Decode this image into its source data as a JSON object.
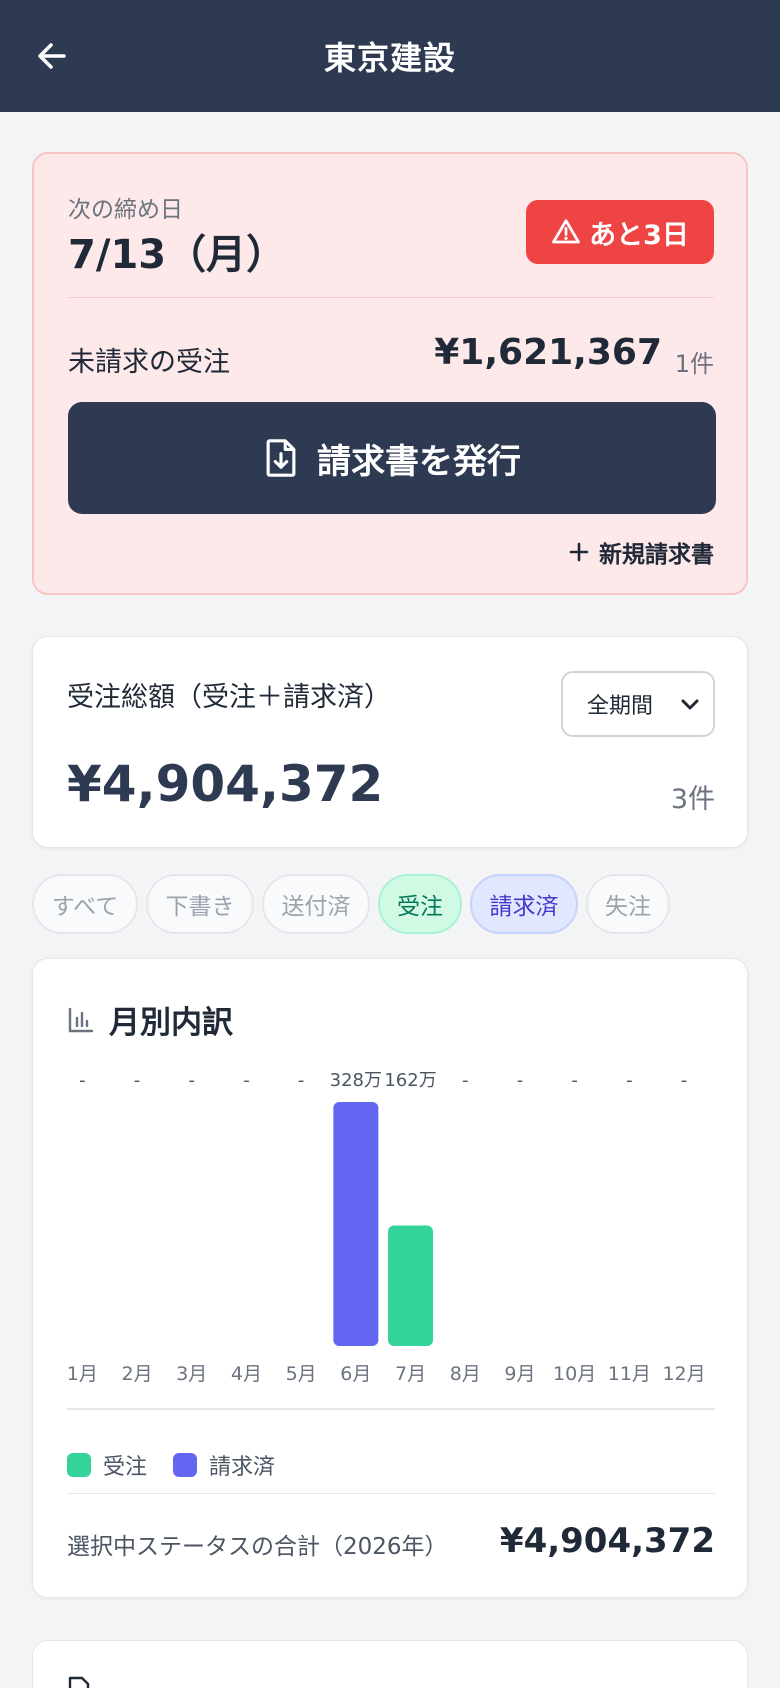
{
  "header": {
    "title": "東京建設",
    "back_icon": "arrow-left-icon"
  },
  "deadline": {
    "label": "次の締め日",
    "date": "7/13（月）",
    "badge": "あと3日",
    "badge_icon": "warning-triangle-icon",
    "badge_color": "#ef4444",
    "unbilled_label": "未請求の受注",
    "unbilled_amount": "¥1,621,367",
    "unbilled_count": "1件",
    "issue_button": "請求書を発行",
    "issue_icon": "file-download-icon",
    "new_invoice": "新規請求書",
    "new_invoice_icon": "plus-icon"
  },
  "total": {
    "label": "受注総額（受注＋請求済）",
    "period_selected": "全期間",
    "amount": "¥4,904,372",
    "count": "3件"
  },
  "filters": [
    {
      "label": "すべて",
      "state": "inactive"
    },
    {
      "label": "下書き",
      "state": "inactive"
    },
    {
      "label": "送付済",
      "state": "inactive"
    },
    {
      "label": "受注",
      "state": "active"
    },
    {
      "label": "請求済",
      "state": "active"
    },
    {
      "label": "失注",
      "state": "inactive"
    }
  ],
  "monthly": {
    "title": "月別内訳",
    "title_icon": "bar-chart-icon",
    "legend": [
      {
        "label": "受注",
        "color": "#34d399"
      },
      {
        "label": "請求済",
        "color": "#6366f1"
      }
    ],
    "sum_label": "選択中ステータスの合計（2026年）",
    "sum_amount": "¥4,904,372"
  },
  "chart_data": {
    "type": "bar",
    "categories": [
      "1月",
      "2月",
      "3月",
      "4月",
      "5月",
      "6月",
      "7月",
      "8月",
      "9月",
      "10月",
      "11月",
      "12月"
    ],
    "value_labels": [
      "-",
      "-",
      "-",
      "-",
      "-",
      "328万",
      "162万",
      "-",
      "-",
      "-",
      "-",
      "-"
    ],
    "values": [
      0,
      0,
      0,
      0,
      0,
      328,
      162,
      0,
      0,
      0,
      0,
      0
    ],
    "bar_statuses": [
      "",
      "",
      "",
      "",
      "",
      "請求済",
      "受注",
      "",
      "",
      "",
      "",
      ""
    ],
    "bar_colors": {
      "受注": "#34d399",
      "請求済": "#6366f1"
    },
    "unit": "万",
    "ymax": 328
  }
}
